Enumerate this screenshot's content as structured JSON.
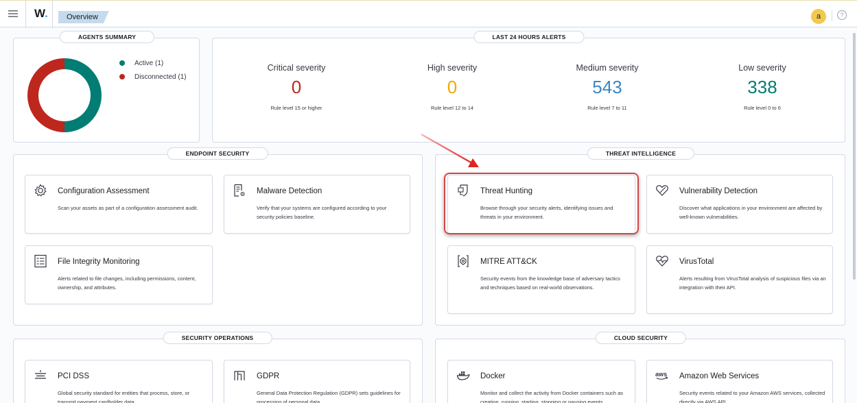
{
  "topbar": {
    "menu_icon": "hamburger-menu-icon",
    "logo_text": "W",
    "logo_dot": ".",
    "breadcrumb": "Overview",
    "avatar_letter": "a",
    "help_icon": "help-circle-icon"
  },
  "agents_summary": {
    "title": "AGENTS SUMMARY",
    "legend": [
      {
        "label": "Active (1)",
        "color": "#017d73",
        "count": 1
      },
      {
        "label": "Disconnected (1)",
        "color": "#bd271e",
        "count": 1
      }
    ]
  },
  "alerts": {
    "title": "LAST 24 HOURS ALERTS",
    "items": [
      {
        "label": "Critical severity",
        "value": "0",
        "sub": "Rule level 15 or higher",
        "color": "#bd271e"
      },
      {
        "label": "High severity",
        "value": "0",
        "sub": "Rule level 12 to 14",
        "color": "#f5a700"
      },
      {
        "label": "Medium severity",
        "value": "543",
        "sub": "Rule level 7 to 11",
        "color": "#3b86c4"
      },
      {
        "label": "Low severity",
        "value": "338",
        "sub": "Rule level 0 to 6",
        "color": "#017d73"
      }
    ]
  },
  "endpoint_security": {
    "title": "ENDPOINT SECURITY",
    "cards": [
      {
        "icon": "gear-icon",
        "title": "Configuration Assessment",
        "desc": "Scan your assets as part of a configuration assessment audit."
      },
      {
        "icon": "document-gear-icon",
        "title": "Malware Detection",
        "desc": "Verify that your systems are configured according to your security policies baseline."
      },
      {
        "icon": "list-document-icon",
        "title": "File Integrity Monitoring",
        "desc": "Alerts related to file changes, including permissions, content, ownership, and attributes."
      }
    ]
  },
  "threat_intelligence": {
    "title": "THREAT INTELLIGENCE",
    "cards": [
      {
        "icon": "shield-hunt-icon",
        "title": "Threat Hunting",
        "desc": "Browse through your security alerts, identifying issues and threats in your environment."
      },
      {
        "icon": "heart-outline-icon",
        "title": "Vulnerability Detection",
        "desc": "Discover what applications in your environment are affected by well-known vulnerabilities."
      },
      {
        "icon": "bracket-target-icon",
        "title": "MITRE ATT&CK",
        "desc": "Security events from the knowledge base of adversary tactics and techniques based on real-world observations."
      },
      {
        "icon": "heartbeat-icon",
        "title": "VirusTotal",
        "desc": "Alerts resulting from VirusTotal analysis of suspicious files via an integration with their API."
      }
    ]
  },
  "security_operations": {
    "title": "SECURITY OPERATIONS",
    "cards": [
      {
        "icon": "card-lines-icon",
        "title": "PCI DSS",
        "desc": "Global security standard for entities that process, store, or transmit payment cardholder data."
      },
      {
        "icon": "building-columns-icon",
        "title": "GDPR",
        "desc": "General Data Protection Regulation (GDPR) sets guidelines for processing of personal data."
      }
    ]
  },
  "cloud_security": {
    "title": "CLOUD SECURITY",
    "cards": [
      {
        "icon": "docker-whale-icon",
        "title": "Docker",
        "desc": "Monitor and collect the activity from Docker containers such as creation, running, starting, stopping or pausing events."
      },
      {
        "icon": "aws-logo-icon",
        "title": "Amazon Web Services",
        "desc": "Security events related to your Amazon AWS services, collected directly via AWS API."
      }
    ]
  }
}
